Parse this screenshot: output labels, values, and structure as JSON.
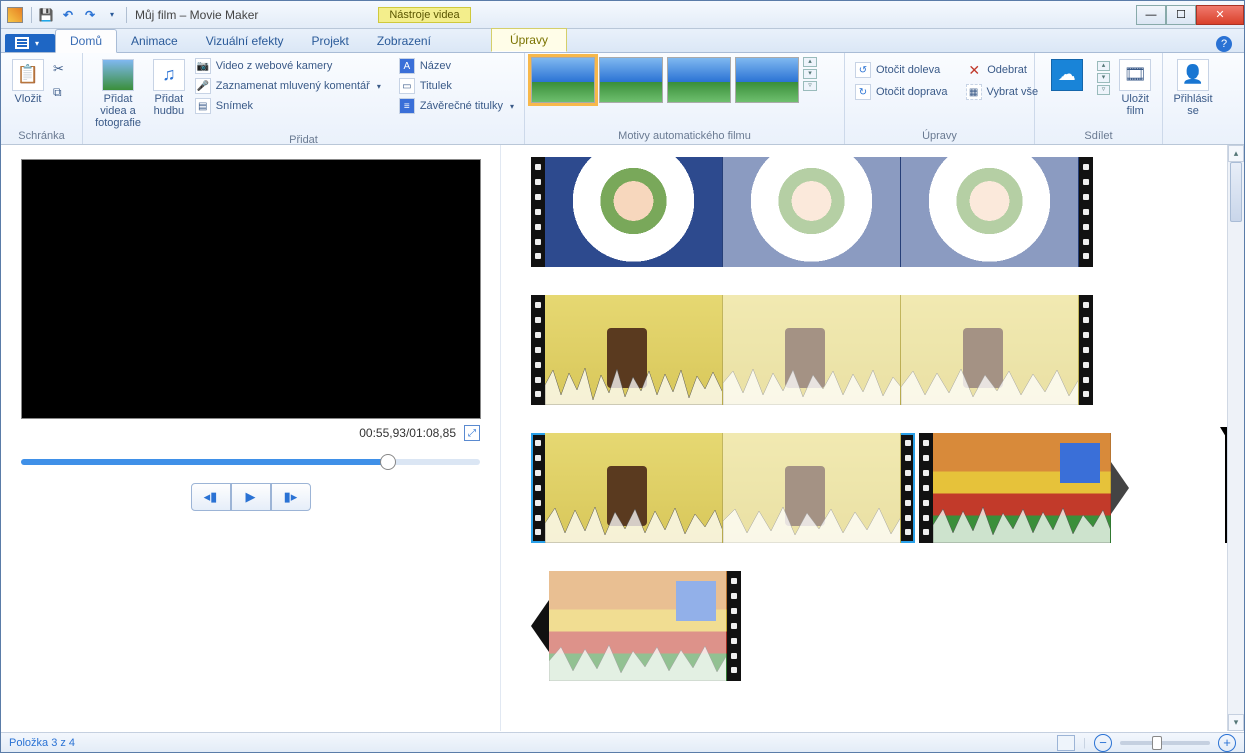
{
  "title": "Můj film – Movie Maker",
  "contextual_tab_group": "Nástroje videa",
  "tabs": {
    "home": "Domů",
    "anim": "Animace",
    "vfx": "Vizuální efekty",
    "project": "Projekt",
    "view": "Zobrazení",
    "edit": "Úpravy"
  },
  "ribbon": {
    "clipboard": {
      "paste": "Vložit",
      "label": "Schránka"
    },
    "add": {
      "add_media": "Přidat videa a fotografie",
      "add_music": "Přidat hudbu",
      "webcam": "Video z webové kamery",
      "narration": "Zaznamenat mluvený komentář",
      "snapshot": "Snímek",
      "title": "Název",
      "caption": "Titulek",
      "credits": "Závěrečné titulky",
      "label": "Přidat"
    },
    "automovie": {
      "label": "Motivy automatického filmu"
    },
    "editing": {
      "rotate_left": "Otočit doleva",
      "rotate_right": "Otočit doprava",
      "remove": "Odebrat",
      "select_all": "Vybrat vše",
      "label": "Úpravy"
    },
    "share": {
      "save": "Uložit film",
      "label": "Sdílet"
    },
    "signin": "Přihlásit se"
  },
  "preview": {
    "time": "00:55,93/01:08,85"
  },
  "status": {
    "item": "Položka 3 z 4"
  }
}
